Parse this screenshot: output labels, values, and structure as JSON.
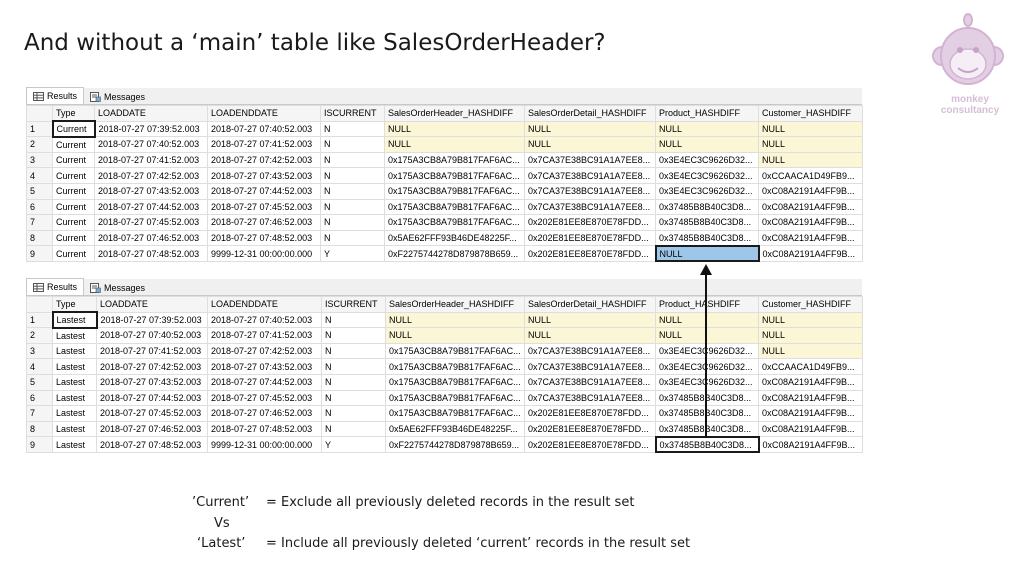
{
  "slide": {
    "title": "And without a ‘main’ table like SalesOrderHeader?"
  },
  "logo": {
    "line1": "monkey",
    "line2": "consultancy",
    "colors": {
      "face": "#e3cfe3",
      "outline": "#d2b4d2"
    }
  },
  "tabs": [
    {
      "label": "Results",
      "icon": "grid-icon"
    },
    {
      "label": "Messages",
      "icon": "messages-icon"
    }
  ],
  "columns": [
    "",
    "Type",
    "LOADDATE",
    "LOADENDDATE",
    "ISCURRENT",
    "SalesOrderHeader_HASHDIFF",
    "SalesOrderDetail_HASHDIFF",
    "Product_HASHDIFF",
    "Customer_HASHDIFF"
  ],
  "grid1": {
    "rows": [
      [
        "1",
        "Current",
        "2018-07-27 07:39:52.003",
        "2018-07-27 07:40:52.003",
        "N",
        "NULL",
        "NULL",
        "NULL",
        "NULL"
      ],
      [
        "2",
        "Current",
        "2018-07-27 07:40:52.003",
        "2018-07-27 07:41:52.003",
        "N",
        "NULL",
        "NULL",
        "NULL",
        "NULL"
      ],
      [
        "3",
        "Current",
        "2018-07-27 07:41:52.003",
        "2018-07-27 07:42:52.003",
        "N",
        "0x175A3CB8A79B817FAF6AC...",
        "0x7CA37E38BC91A1A7EE8...",
        "0x3E4EC3C9626D32...",
        "NULL"
      ],
      [
        "4",
        "Current",
        "2018-07-27 07:42:52.003",
        "2018-07-27 07:43:52.003",
        "N",
        "0x175A3CB8A79B817FAF6AC...",
        "0x7CA37E38BC91A1A7EE8...",
        "0x3E4EC3C9626D32...",
        "0xCCAACA1D49FB9..."
      ],
      [
        "5",
        "Current",
        "2018-07-27 07:43:52.003",
        "2018-07-27 07:44:52.003",
        "N",
        "0x175A3CB8A79B817FAF6AC...",
        "0x7CA37E38BC91A1A7EE8...",
        "0x3E4EC3C9626D32...",
        "0xC08A2191A4FF9B..."
      ],
      [
        "6",
        "Current",
        "2018-07-27 07:44:52.003",
        "2018-07-27 07:45:52.003",
        "N",
        "0x175A3CB8A79B817FAF6AC...",
        "0x7CA37E38BC91A1A7EE8...",
        "0x37485B8B40C3D8...",
        "0xC08A2191A4FF9B..."
      ],
      [
        "7",
        "Current",
        "2018-07-27 07:45:52.003",
        "2018-07-27 07:46:52.003",
        "N",
        "0x175A3CB8A79B817FAF6AC...",
        "0x202E81EE8E870E78FDD...",
        "0x37485B8B40C3D8...",
        "0xC08A2191A4FF9B..."
      ],
      [
        "8",
        "Current",
        "2018-07-27 07:46:52.003",
        "2018-07-27 07:48:52.003",
        "N",
        "0x5AE62FFF93B46DE48225F...",
        "0x202E81EE8E870E78FDD...",
        "0x37485B8B40C3D8...",
        "0xC08A2191A4FF9B..."
      ],
      [
        "9",
        "Current",
        "2018-07-27 07:48:52.003",
        "9999-12-31 00:00:00.000",
        "Y",
        "0xF2275744278D879878B659...",
        "0x202E81EE8E870E78FDD...",
        "NULL",
        "0xC08A2191A4FF9B..."
      ]
    ]
  },
  "grid2": {
    "rows": [
      [
        "1",
        "Lastest",
        "2018-07-27 07:39:52.003",
        "2018-07-27 07:40:52.003",
        "N",
        "NULL",
        "NULL",
        "NULL",
        "NULL"
      ],
      [
        "2",
        "Lastest",
        "2018-07-27 07:40:52.003",
        "2018-07-27 07:41:52.003",
        "N",
        "NULL",
        "NULL",
        "NULL",
        "NULL"
      ],
      [
        "3",
        "Lastest",
        "2018-07-27 07:41:52.003",
        "2018-07-27 07:42:52.003",
        "N",
        "0x175A3CB8A79B817FAF6AC...",
        "0x7CA37E38BC91A1A7EE8...",
        "0x3E4EC3C9626D32...",
        "NULL"
      ],
      [
        "4",
        "Lastest",
        "2018-07-27 07:42:52.003",
        "2018-07-27 07:43:52.003",
        "N",
        "0x175A3CB8A79B817FAF6AC...",
        "0x7CA37E38BC91A1A7EE8...",
        "0x3E4EC3C9626D32...",
        "0xCCAACA1D49FB9..."
      ],
      [
        "5",
        "Lastest",
        "2018-07-27 07:43:52.003",
        "2018-07-27 07:44:52.003",
        "N",
        "0x175A3CB8A79B817FAF6AC...",
        "0x7CA37E38BC91A1A7EE8...",
        "0x3E4EC3C9626D32...",
        "0xC08A2191A4FF9B..."
      ],
      [
        "6",
        "Lastest",
        "2018-07-27 07:44:52.003",
        "2018-07-27 07:45:52.003",
        "N",
        "0x175A3CB8A79B817FAF6AC...",
        "0x7CA37E38BC91A1A7EE8...",
        "0x37485B8B40C3D8...",
        "0xC08A2191A4FF9B..."
      ],
      [
        "7",
        "Lastest",
        "2018-07-27 07:45:52.003",
        "2018-07-27 07:46:52.003",
        "N",
        "0x175A3CB8A79B817FAF6AC...",
        "0x202E81EE8E870E78FDD...",
        "0x37485B8B40C3D8...",
        "0xC08A2191A4FF9B..."
      ],
      [
        "8",
        "Lastest",
        "2018-07-27 07:46:52.003",
        "2018-07-27 07:48:52.003",
        "N",
        "0x5AE62FFF93B46DE48225F...",
        "0x202E81EE8E870E78FDD...",
        "0x37485B8B40C3D8...",
        "0xC08A2191A4FF9B..."
      ],
      [
        "9",
        "Lastest",
        "2018-07-27 07:48:52.003",
        "9999-12-31 00:00:00.000",
        "Y",
        "0xF2275744278D879878B659...",
        "0x202E81EE8E870E78FDD...",
        "0x37485B8B40C3D8...",
        "0xC08A2191A4FF9B..."
      ]
    ]
  },
  "legend": {
    "current_term": "’Current’",
    "current_desc": "= Exclude all previously deleted records in the result set",
    "vs": "Vs",
    "latest_term": "‘Latest’",
    "latest_desc": "= Include all previously deleted ‘current’ records in the result set"
  }
}
